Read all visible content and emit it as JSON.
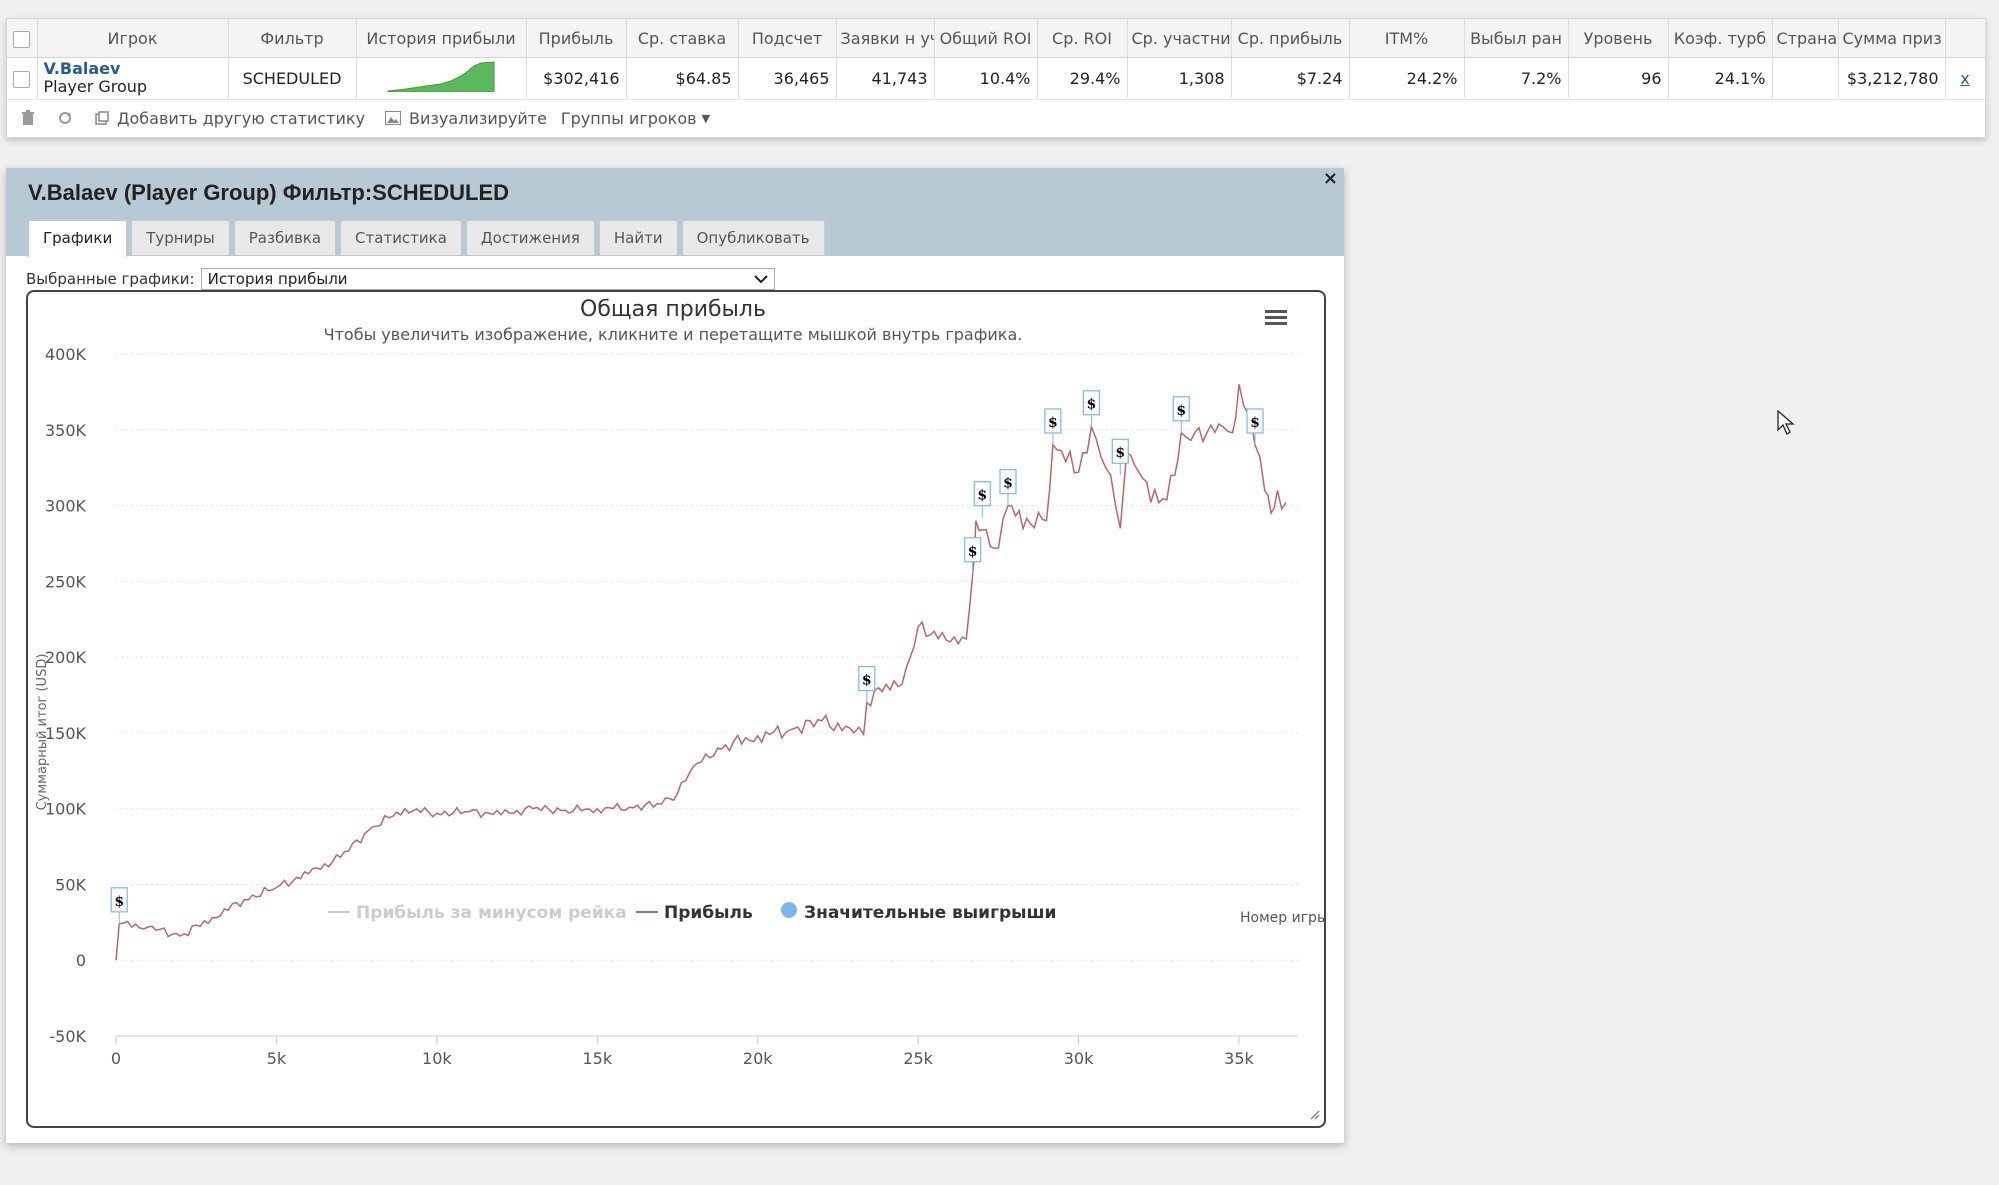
{
  "stats": {
    "headers": [
      "Игрок",
      "Фильтр",
      "История прибыли",
      "Прибыль",
      "Ср. ставка",
      "Подсчет",
      "Заявки н уч",
      "Общий ROI",
      "Ср. ROI",
      "Ср. участни",
      "Ср. прибыль",
      "ITM%",
      "Выбыл ран",
      "Уровень",
      "Коэф. турб",
      "Страна",
      "Сумма приз"
    ],
    "row": {
      "player_name": "V.Balaev",
      "player_group": "Player Group",
      "filter": "SCHEDULED",
      "profit": "$302,416",
      "avg_stake": "$64.85",
      "count": "36,465",
      "entries": "41,743",
      "total_roi": "10.4%",
      "avg_roi": "29.4%",
      "avg_field": "1,308",
      "avg_profit": "$7.24",
      "itm": "24.2%",
      "early_out": "7.2%",
      "level": "96",
      "turbo_ratio": "24.1%",
      "country": "",
      "prize_sum": "$3,212,780",
      "remove": "x"
    },
    "toolbar": {
      "add_stat": "Добавить другую статистику",
      "visualize": "Визуализируйте",
      "player_groups": "Группы игроков"
    }
  },
  "dialog": {
    "title": "V.Balaev (Player Group) Фильтр:SCHEDULED",
    "close": "×",
    "tabs": [
      "Графики",
      "Турниры",
      "Разбивка",
      "Статистика",
      "Достижения",
      "Найти",
      "Опубликовать"
    ],
    "active_tab": 0,
    "selected_label": "Выбранные графики:",
    "selected_value": "История прибыли"
  },
  "colors": {
    "profit_line": "#b5696a",
    "rake_line": "#cccccc",
    "big_wins": "#7cb5ec",
    "sparkline": "#5cb85c",
    "header_bg": "#b6c9d4",
    "link": "#2a5a8f"
  },
  "chart_data": {
    "type": "line",
    "title": "Общая прибыль",
    "subtitle": "Чтобы увеличить изображение, кликните и перетащите мышкой внутрь графика.",
    "ylabel": "Суммарный итог (USD)",
    "xlabel": "Номер игры",
    "xlim": [
      0,
      36465
    ],
    "ylim": [
      -50000,
      400000
    ],
    "x_ticks": [
      0,
      5000,
      10000,
      15000,
      20000,
      25000,
      30000,
      35000
    ],
    "x_tick_labels": [
      "0",
      "5k",
      "10k",
      "15k",
      "20k",
      "25k",
      "30k",
      "35k"
    ],
    "y_ticks": [
      -50000,
      0,
      50000,
      100000,
      150000,
      200000,
      250000,
      300000,
      350000,
      400000
    ],
    "y_tick_labels": [
      "-50K",
      "0",
      "50K",
      "100K",
      "150K",
      "200K",
      "250K",
      "300K",
      "350K",
      "400K"
    ],
    "grid": true,
    "legend_position": "bottom",
    "series": [
      {
        "name": "Прибыль за минусом рейка",
        "visible": false,
        "x": [],
        "y": []
      },
      {
        "name": "Прибыль",
        "visible": true,
        "x": [
          0,
          100,
          1000,
          2000,
          3000,
          4000,
          5000,
          6000,
          7000,
          8000,
          9000,
          10000,
          11000,
          12000,
          13000,
          14000,
          15000,
          16000,
          17000,
          17500,
          18000,
          19000,
          20000,
          21000,
          22000,
          23000,
          23300,
          23400,
          24000,
          24500,
          25000,
          26000,
          26500,
          26700,
          26800,
          27000,
          27500,
          27800,
          28500,
          29000,
          29200,
          30000,
          30400,
          30700,
          31000,
          31300,
          31500,
          32000,
          32500,
          33000,
          33200,
          33500,
          34000,
          34500,
          34800,
          35000,
          35300,
          35500,
          35800,
          36000,
          36200,
          36465
        ],
        "y": [
          0,
          24000,
          22000,
          16000,
          28000,
          40000,
          48000,
          57000,
          68000,
          88000,
          100000,
          97000,
          98000,
          96000,
          100000,
          99000,
          100000,
          101000,
          103000,
          110000,
          128000,
          142000,
          148000,
          152000,
          158000,
          150000,
          149000,
          170000,
          182000,
          182000,
          220000,
          210000,
          212000,
          255000,
          290000,
          284000,
          272000,
          300000,
          288000,
          290000,
          340000,
          322000,
          352000,
          332000,
          320000,
          285000,
          335000,
          318000,
          302000,
          320000,
          348000,
          343000,
          348000,
          352000,
          348000,
          380000,
          360000,
          340000,
          310000,
          295000,
          310000,
          302000
        ]
      },
      {
        "name": "Значительные выигрыши",
        "visible": true,
        "marker": "$",
        "x": [
          100,
          23400,
          26700,
          27000,
          27800,
          29200,
          30400,
          31300,
          33200,
          35500
        ],
        "y": [
          24000,
          170000,
          255000,
          292000,
          300000,
          340000,
          352000,
          320000,
          348000,
          340000
        ]
      }
    ]
  }
}
